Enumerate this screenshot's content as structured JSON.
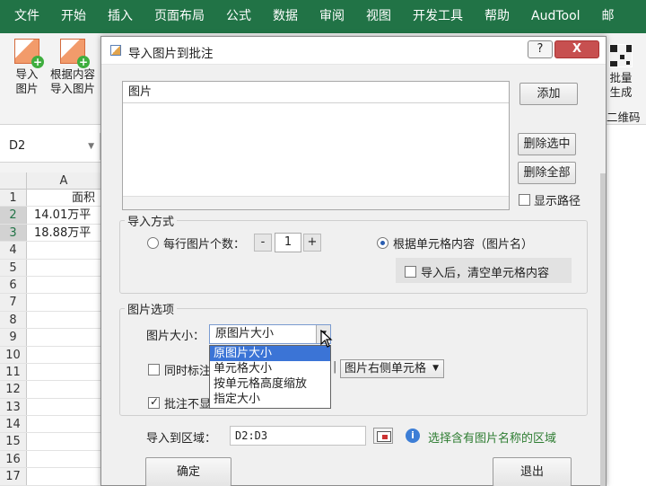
{
  "ribbon": {
    "tabs": [
      "文件",
      "开始",
      "插入",
      "页面布局",
      "公式",
      "数据",
      "审阅",
      "视图",
      "开发工具",
      "帮助",
      "AudTool",
      "邮"
    ],
    "buttons": [
      {
        "line1": "导入",
        "line2": "图片"
      },
      {
        "line1": "根据内容",
        "line2": "导入图片"
      },
      {
        "line1": "批量",
        "line2": "生成"
      }
    ],
    "qr_label": "二维码"
  },
  "namebox": {
    "value": "D2"
  },
  "sheet": {
    "col_a": "A",
    "rows": [
      {
        "num": "1",
        "a": "面积"
      },
      {
        "num": "2",
        "a": "14.01万平"
      },
      {
        "num": "3",
        "a": "18.88万平"
      },
      {
        "num": "4",
        "a": ""
      },
      {
        "num": "5",
        "a": ""
      },
      {
        "num": "6",
        "a": ""
      },
      {
        "num": "7",
        "a": ""
      },
      {
        "num": "8",
        "a": ""
      },
      {
        "num": "9",
        "a": ""
      },
      {
        "num": "10",
        "a": ""
      },
      {
        "num": "11",
        "a": ""
      },
      {
        "num": "12",
        "a": ""
      },
      {
        "num": "13",
        "a": ""
      },
      {
        "num": "14",
        "a": ""
      },
      {
        "num": "15",
        "a": ""
      },
      {
        "num": "16",
        "a": ""
      },
      {
        "num": "17",
        "a": ""
      }
    ]
  },
  "dialog": {
    "title": "导入图片到批注",
    "help": "?",
    "close": "X",
    "list_header": "图片",
    "add": "添加",
    "delete_selected": "删除选中",
    "delete_all": "删除全部",
    "show_path": "显示路径",
    "import_mode": {
      "title": "导入方式",
      "per_row_label": "每行图片个数：",
      "minus": "-",
      "count": "1",
      "plus": "+",
      "by_content": "根据单元格内容（图片名）",
      "clear_after": "导入后，清空单元格内容"
    },
    "picture_options": {
      "title": "图片选项",
      "size_label": "图片大小：",
      "size_value": "原图片大小",
      "size_options": [
        "原图片大小",
        "单元格大小",
        "按单元格高度缩放",
        "指定大小"
      ],
      "mark_label": "同时标注",
      "position_value": "图片右侧单元格",
      "comment_label": "批注不显"
    },
    "range_label": "导入到区域：",
    "range_value": "D2:D3",
    "range_hint": "选择含有图片名称的区域",
    "ok": "确定",
    "exit": "退出"
  }
}
